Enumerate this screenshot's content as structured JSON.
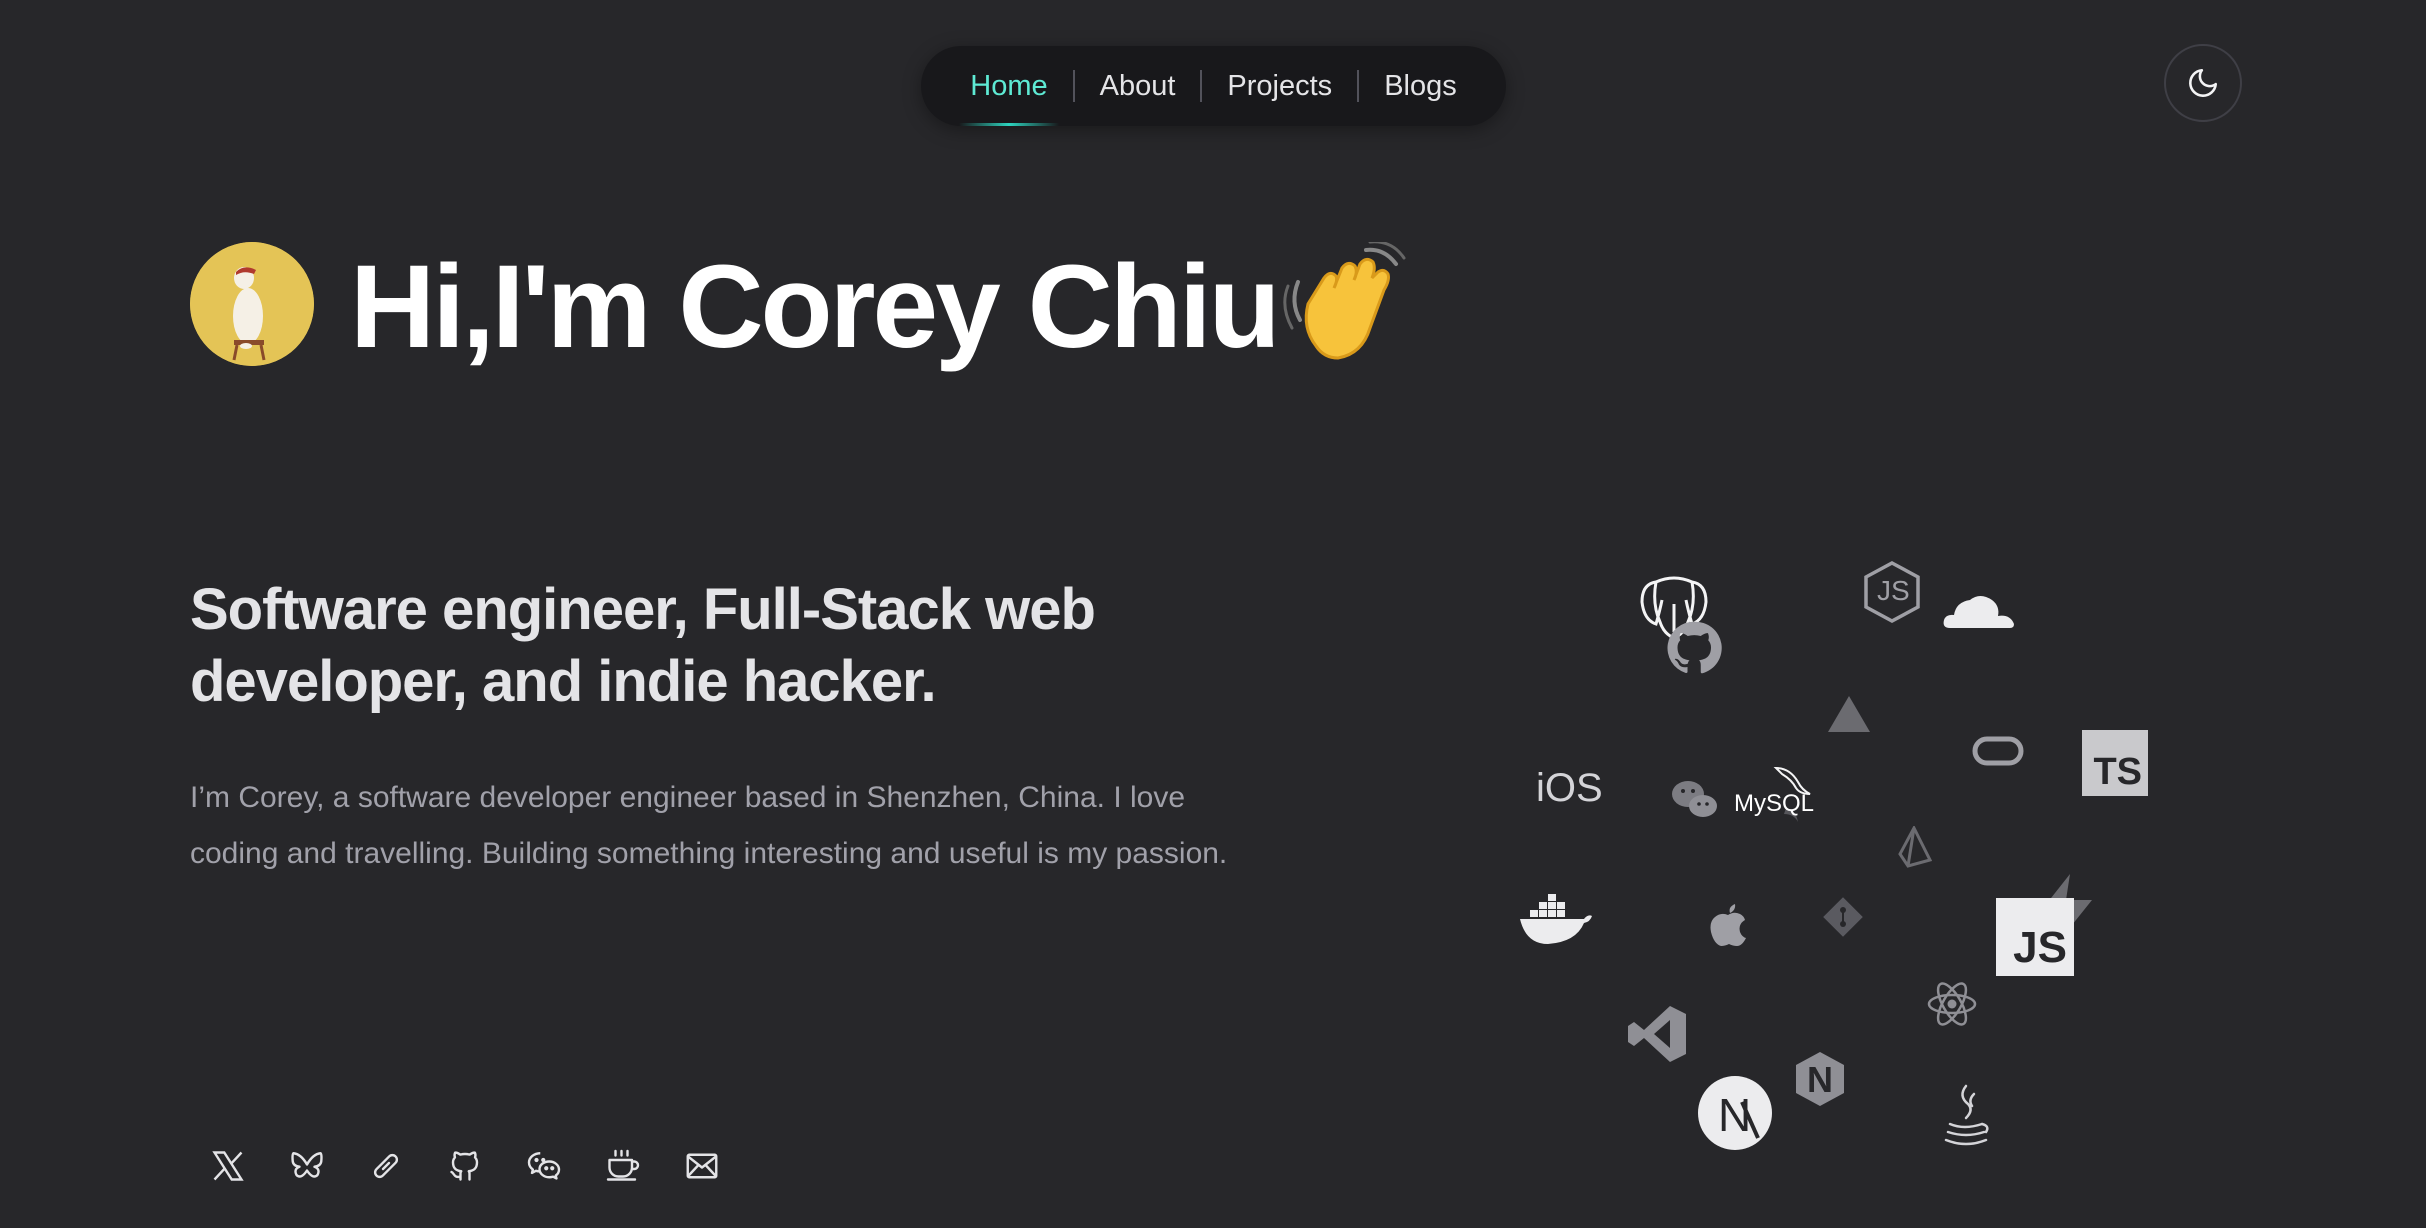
{
  "nav": {
    "items": [
      {
        "label": "Home",
        "active": true
      },
      {
        "label": "About",
        "active": false
      },
      {
        "label": "Projects",
        "active": false
      },
      {
        "label": "Blogs",
        "active": false
      }
    ]
  },
  "theme_toggle": {
    "icon": "moon-icon"
  },
  "hero": {
    "title": "Hi,I'm Corey Chiu",
    "wave_icon": "waving-hand-icon",
    "tagline": "Software engineer, Full-Stack web developer, and indie hacker.",
    "intro": "I’m Corey, a software developer engineer based in Shenzhen, China. I love coding and travelling. Building something interesting and useful is my passion."
  },
  "tech_cloud": {
    "ios_label": "iOS",
    "mysql_label": "MySQL",
    "ts_label": "TS",
    "js_label": "JS",
    "nodejs_label": "JS",
    "nextjs_label": "N",
    "nginx_label": "N"
  },
  "socials": [
    {
      "icon": "x-twitter-icon"
    },
    {
      "icon": "bluesky-icon"
    },
    {
      "icon": "link-icon"
    },
    {
      "icon": "github-icon"
    },
    {
      "icon": "wechat-icon"
    },
    {
      "icon": "coffee-icon"
    },
    {
      "icon": "mail-icon"
    }
  ],
  "colors": {
    "background": "#27272a",
    "accent": "#5eead4",
    "nav_bg": "#18181b"
  }
}
